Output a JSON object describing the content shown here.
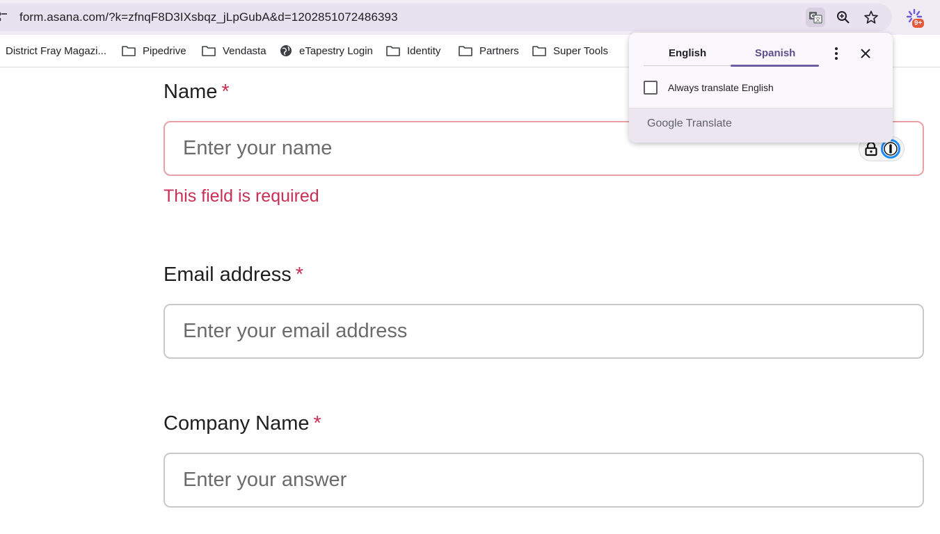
{
  "browser": {
    "url": "form.asana.com/?k=zfnqF8D3IXsbqz_jLpGubA&d=1202851072486393",
    "extension_badge": "9+"
  },
  "bookmarks": [
    {
      "label": "District Fray Magazi...",
      "icon": "none"
    },
    {
      "label": "Pipedrive",
      "icon": "folder-icon"
    },
    {
      "label": "Vendasta",
      "icon": "folder-icon"
    },
    {
      "label": "eTapestry Login",
      "icon": "globe-icon"
    },
    {
      "label": "Identity",
      "icon": "folder-icon"
    },
    {
      "label": "Partners",
      "icon": "folder-icon"
    },
    {
      "label": "Super Tools",
      "icon": "folder-icon"
    }
  ],
  "translate_popup": {
    "tab_source": "English",
    "tab_target": "Spanish",
    "active_tab": "Spanish",
    "checkbox_label": "Always translate English",
    "checkbox_checked": false,
    "footer_brand": "Google",
    "footer_product": "Translate"
  },
  "form": {
    "name": {
      "label": "Name",
      "required_mark": "*",
      "placeholder": "Enter your name",
      "error": "This field is required"
    },
    "email": {
      "label": "Email address",
      "required_mark": "*",
      "placeholder": "Enter your email address"
    },
    "company": {
      "label": "Company Name",
      "required_mark": "*",
      "placeholder": "Enter your answer"
    }
  },
  "colors": {
    "required": "#c92f54",
    "error_border": "#eaa0a7",
    "accent_tab": "#6b5fa3"
  }
}
